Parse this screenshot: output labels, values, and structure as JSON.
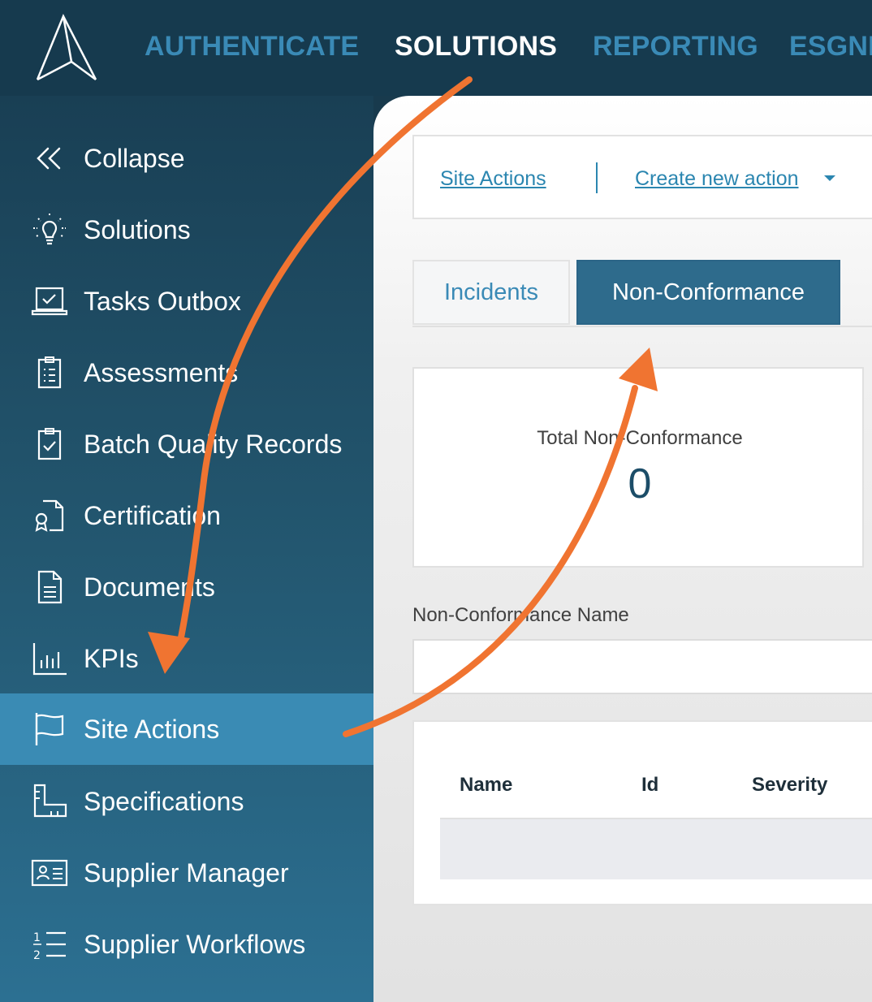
{
  "header": {
    "logo_icon": "a-logo-icon",
    "nav": [
      {
        "label": "AUTHENTICATE",
        "active": false
      },
      {
        "label": "SOLUTIONS",
        "active": true
      },
      {
        "label": "REPORTING",
        "active": false
      },
      {
        "label": "ESGNI",
        "active": false
      }
    ]
  },
  "sidebar": {
    "items": [
      {
        "label": "Collapse",
        "icon": "double-chevron-left-icon"
      },
      {
        "label": "Solutions",
        "icon": "lightbulb-icon"
      },
      {
        "label": "Tasks Outbox",
        "icon": "laptop-check-icon"
      },
      {
        "label": "Assessments",
        "icon": "clipboard-list-icon"
      },
      {
        "label": "Batch Quality Records",
        "icon": "clipboard-check-icon"
      },
      {
        "label": "Certification",
        "icon": "certificate-icon"
      },
      {
        "label": "Documents",
        "icon": "document-icon"
      },
      {
        "label": "KPIs",
        "icon": "bar-chart-icon"
      },
      {
        "label": "Site Actions",
        "icon": "flag-icon",
        "active": true
      },
      {
        "label": "Specifications",
        "icon": "ruler-icon"
      },
      {
        "label": "Supplier Manager",
        "icon": "id-card-icon"
      },
      {
        "label": "Supplier Workflows",
        "icon": "numbered-list-icon"
      }
    ]
  },
  "toolbar": {
    "site_actions_link": "Site Actions",
    "create_action_link": "Create new action"
  },
  "tabs": [
    {
      "label": "Incidents",
      "active": false
    },
    {
      "label": "Non-Conformance",
      "active": true
    }
  ],
  "stat": {
    "label": "Total Non-Conformance",
    "value": "0"
  },
  "filter": {
    "label": "Non-Conformance Name",
    "value": ""
  },
  "table": {
    "columns": [
      "Name",
      "Id",
      "Severity"
    ],
    "rows": []
  },
  "colors": {
    "annotation_arrow": "#f07431",
    "accent": "#3a8ab6",
    "active_tab": "#2e6b8c"
  }
}
